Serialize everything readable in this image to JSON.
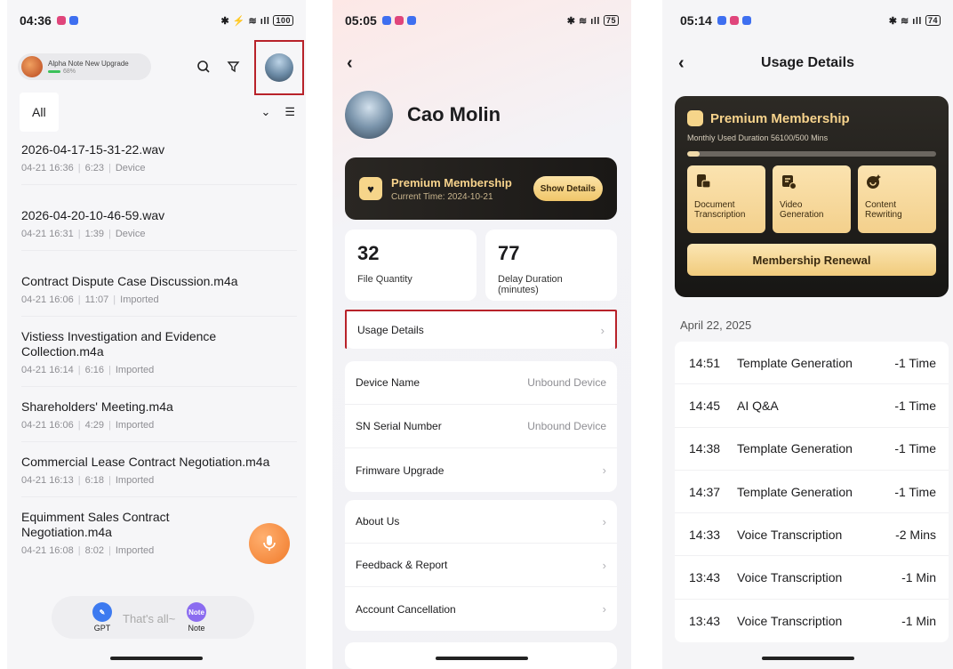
{
  "screen1": {
    "status": {
      "time": "04:36",
      "battery": "100"
    },
    "model": {
      "name": "Alpha Note New Upgrade",
      "level": "68%"
    },
    "filter": {
      "label": "All"
    },
    "recordings": [
      {
        "title": "2026-04-17-15-31-22.wav",
        "date": "04-21 16:36",
        "duration": "6:23",
        "source": "Device"
      },
      {
        "title": "2026-04-20-10-46-59.wav",
        "date": "04-21 16:31",
        "duration": "1:39",
        "source": "Device"
      },
      {
        "title": "Contract Dispute Case Discussion.m4a",
        "date": "04-21 16:06",
        "duration": "11:07",
        "source": "Imported"
      },
      {
        "title": "Vistiess Investigation and Evidence Collection.m4a",
        "date": "04-21 16:14",
        "duration": "6:16",
        "source": "Imported"
      },
      {
        "title": "Shareholders' Meeting.m4a",
        "date": "04-21 16:06",
        "duration": "4:29",
        "source": "Imported"
      },
      {
        "title": "Commercial Lease Contract Negotiation.m4a",
        "date": "04-21 16:13",
        "duration": "6:18",
        "source": "Imported"
      },
      {
        "title": "Equimment Sales Contract Negotiation.m4a",
        "date": "04-21 16:08",
        "duration": "8:02",
        "source": "Imported"
      }
    ],
    "bottom": {
      "gpt_label": "GPT",
      "end_text": "That's all~",
      "note_label": "Note",
      "note_icon_text": "Note"
    }
  },
  "screen2": {
    "status": {
      "time": "05:05",
      "battery": "75"
    },
    "user": {
      "name": "Cao Molin"
    },
    "membership": {
      "title": "Premium Membership",
      "current_time": "Current Time: 2024-10-21",
      "button": "Show Details"
    },
    "stats": [
      {
        "value": "32",
        "label": "File Quantity"
      },
      {
        "value": "77",
        "label": "Delay Duration (minutes)"
      }
    ],
    "usage_row": "Usage Details",
    "device_rows": [
      {
        "label": "Device Name",
        "value": "Unbound Device"
      },
      {
        "label": "SN Serial Number",
        "value": "Unbound Device"
      },
      {
        "label": "Frimware Upgrade",
        "value": ""
      }
    ],
    "other_rows": [
      "About Us",
      "Feedback & Report",
      "Account Cancellation"
    ]
  },
  "screen3": {
    "status": {
      "time": "05:14",
      "battery": "74"
    },
    "title": "Usage Details",
    "membership": {
      "title": "Premium Membership",
      "subtitle": "Monthly Used Duration 56100/500 Mins",
      "progress": 0.05,
      "tiles": [
        {
          "label": "Document Transcription",
          "icon": "document-icon"
        },
        {
          "label": "Video Generation",
          "icon": "video-icon"
        },
        {
          "label": "Content Rewriting",
          "icon": "rewrite-icon"
        }
      ],
      "renew_button": "Membership Renewal"
    },
    "date": "April 22, 2025",
    "usage": [
      {
        "time": "14:51",
        "name": "Template Generation",
        "amount": "-1 Time"
      },
      {
        "time": "14:45",
        "name": "AI Q&A",
        "amount": "-1 Time"
      },
      {
        "time": "14:38",
        "name": "Template Generation",
        "amount": "-1 Time"
      },
      {
        "time": "14:37",
        "name": "Template Generation",
        "amount": "-1 Time"
      },
      {
        "time": "14:33",
        "name": "Voice Transcription",
        "amount": "-2 Mins"
      },
      {
        "time": "13:43",
        "name": "Voice Transcription",
        "amount": "-1 Min"
      },
      {
        "time": "13:43",
        "name": "Voice Transcription",
        "amount": "-1 Min"
      }
    ]
  },
  "colors": {
    "accent_gold": "#f7d38c",
    "highlight_red": "#b8222a",
    "fab_orange": "#f07a2a"
  }
}
